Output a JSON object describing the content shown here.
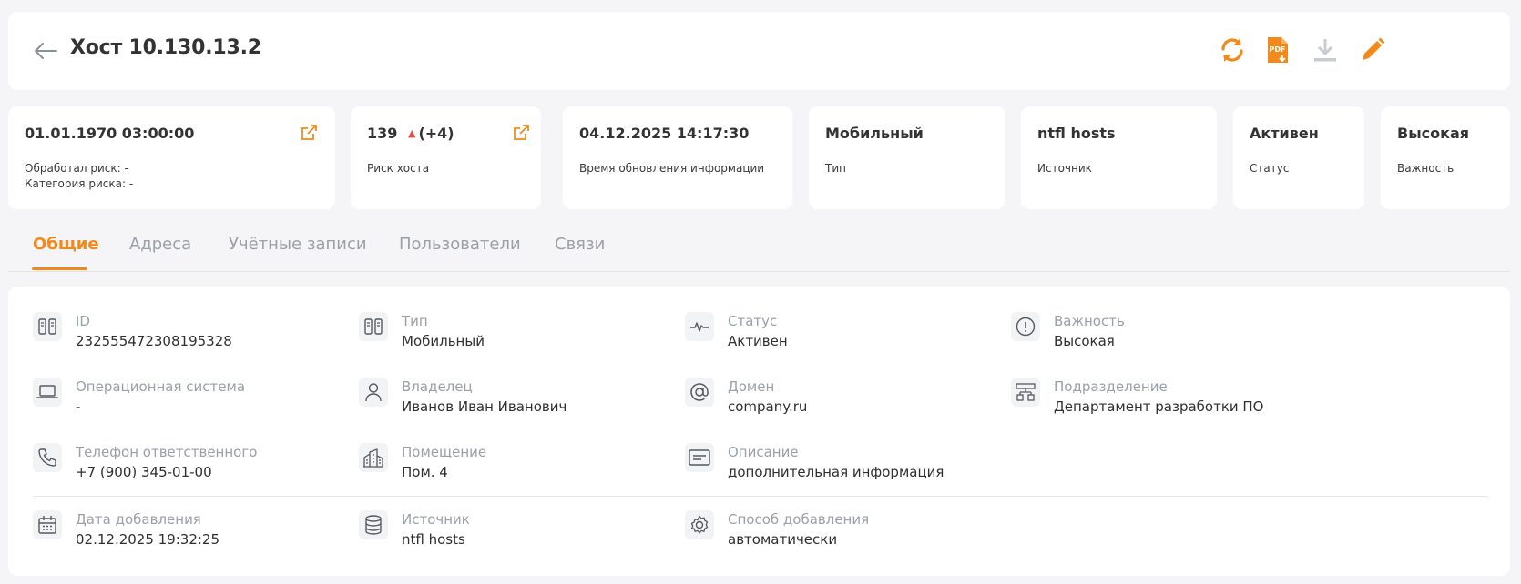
{
  "header": {
    "title": "Хост 10.130.13.2"
  },
  "colors": {
    "accent": "#f18a1b",
    "danger": "#ef4b4b",
    "muted": "#9aa0a8",
    "disabled": "#c8cbd0"
  },
  "toolbar": [
    "refresh-icon",
    "pdf-export-icon",
    "download-icon",
    "edit-icon"
  ],
  "info_cards": {
    "risk_processed": {
      "value": "01.01.1970 03:00:00",
      "label1": "Обработал риск: -",
      "label2": "Категория риска: -"
    },
    "host_risk": {
      "value": "139",
      "delta": "(+4)",
      "label": "Риск хоста"
    },
    "updated": {
      "value": "04.12.2025 14:17:30",
      "label": "Время обновления информации"
    },
    "type": {
      "value": "Мобильный",
      "label": "Тип"
    },
    "source": {
      "value": "ntfl hosts",
      "label": "Источник"
    },
    "status": {
      "value": "Активен",
      "label": "Статус"
    },
    "importance": {
      "value": "Высокая",
      "label": "Важность"
    }
  },
  "tabs": [
    {
      "label": "Общие",
      "active": true
    },
    {
      "label": "Адреса",
      "active": false
    },
    {
      "label": "Учётные записи",
      "active": false
    },
    {
      "label": "Пользователи",
      "active": false
    },
    {
      "label": "Связи",
      "active": false
    }
  ],
  "fields": {
    "id": {
      "label": "ID",
      "value": "232555472308195328"
    },
    "type": {
      "label": "Тип",
      "value": "Мобильный"
    },
    "status": {
      "label": "Статус",
      "value": "Активен"
    },
    "importance": {
      "label": "Важность",
      "value": "Высокая"
    },
    "os": {
      "label": "Операционная система",
      "value": "-"
    },
    "owner": {
      "label": "Владелец",
      "value": "Иванов Иван Иванович"
    },
    "domain": {
      "label": "Домен",
      "value": "company.ru"
    },
    "department": {
      "label": "Подразделение",
      "value": "Департамент разработки ПО"
    },
    "phone": {
      "label": "Телефон ответственного",
      "value": "+7 (900) 345-01-00"
    },
    "room": {
      "label": "Помещение",
      "value": "Пом. 4"
    },
    "description": {
      "label": "Описание",
      "value": "дополнительная информация"
    },
    "date_added": {
      "label": "Дата добавления",
      "value": "02.12.2025 19:32:25"
    },
    "source": {
      "label": "Источник",
      "value": "ntfl hosts"
    },
    "add_method": {
      "label": "Способ добавления",
      "value": "автоматически"
    }
  }
}
